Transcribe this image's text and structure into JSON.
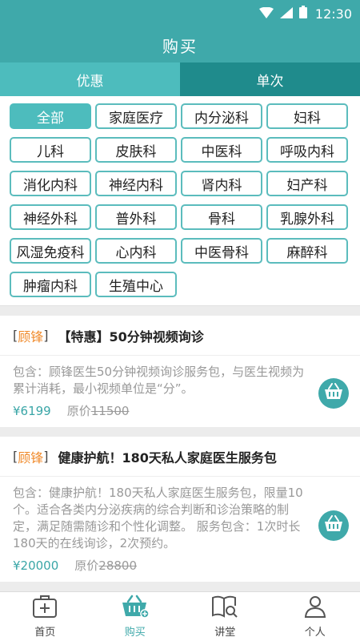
{
  "status": {
    "time": "12:30",
    "icons": [
      "wifi-icon",
      "signal-icon",
      "battery-icon"
    ]
  },
  "header": {
    "title": "购买"
  },
  "tabs": [
    {
      "label": "优惠",
      "active": true
    },
    {
      "label": "单次",
      "active": false
    }
  ],
  "categories": [
    "全部",
    "家庭医疗",
    "内分泌科",
    "妇科",
    "儿科",
    "皮肤科",
    "中医科",
    "呼吸内科",
    "消化内科",
    "神经内科",
    "肾内科",
    "妇产科",
    "神经外科",
    "普外科",
    "骨科",
    "乳腺外科",
    "风湿免疫科",
    "心内科",
    "中医骨科",
    "麻醉科",
    "肿瘤内科",
    "生殖中心"
  ],
  "selected_category": "全部",
  "products": [
    {
      "brand": "顾锋",
      "title": "【特惠】50分钟视频询诊",
      "description": "包含：顾锋医生50分钟视频询诊服务包，与医生视频为累计消耗，最小视频单位是“分”。",
      "price": "¥6199",
      "original_label": "原价",
      "original_price": "11500"
    },
    {
      "brand": "顾锋",
      "title": "健康护航！180天私人家庭医生服务包",
      "description": "包含：健康护航！180天私人家庭医生服务包，限量10个。适合各类内分泌疾病的综合判断和诊治策略的制定，满足随需随诊和个性化调整。 服务包含：1次时长180天的在线询诊，2次预约。",
      "price": "¥20000",
      "original_label": "原价",
      "original_price": "28800"
    }
  ],
  "bottom_nav": [
    {
      "label": "首页",
      "icon": "medical-kit-icon",
      "active": false
    },
    {
      "label": "购买",
      "icon": "basket-icon",
      "active": true
    },
    {
      "label": "讲堂",
      "icon": "book-search-icon",
      "active": false
    },
    {
      "label": "个人",
      "icon": "person-icon",
      "active": false
    }
  ],
  "colors": {
    "primary": "#3fa9aa",
    "tab_active": "#4dbcbd",
    "tab_inactive": "#1f8b8c",
    "brand": "#f08b2d"
  }
}
